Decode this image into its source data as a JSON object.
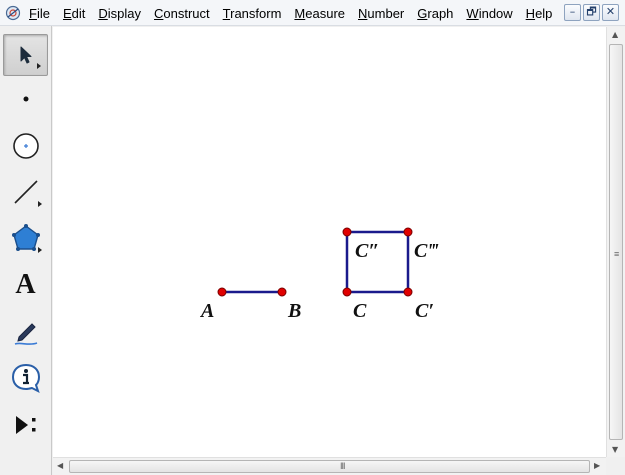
{
  "menu": {
    "items": [
      {
        "ul": "F",
        "rest": "ile"
      },
      {
        "ul": "E",
        "rest": "dit"
      },
      {
        "ul": "D",
        "rest": "isplay"
      },
      {
        "ul": "C",
        "rest": "onstruct"
      },
      {
        "ul": "T",
        "rest": "ransform"
      },
      {
        "ul": "M",
        "rest": "easure"
      },
      {
        "ul": "N",
        "rest": "umber"
      },
      {
        "ul": "G",
        "rest": "raph"
      },
      {
        "ul": "W",
        "rest": "indow"
      },
      {
        "ul": "H",
        "rest": "elp"
      }
    ]
  },
  "window_buttons": {
    "minimize": "–",
    "restore": "🗗",
    "close": "✕"
  },
  "toolbox": {
    "tools": [
      {
        "name": "arrow-tool",
        "icon": "arrow-icon"
      },
      {
        "name": "point-tool",
        "icon": "point-icon"
      },
      {
        "name": "compass-tool",
        "icon": "circle-icon"
      },
      {
        "name": "straightedge-tool",
        "icon": "line-icon"
      },
      {
        "name": "polygon-tool",
        "icon": "pentagon-icon"
      },
      {
        "name": "text-tool",
        "icon": "text-icon",
        "glyph": "A"
      },
      {
        "name": "marker-tool",
        "icon": "pen-icon"
      },
      {
        "name": "information-tool",
        "icon": "info-icon"
      },
      {
        "name": "custom-tool",
        "icon": "play-icon"
      }
    ]
  },
  "sketch": {
    "labels": {
      "A": "A",
      "B": "B",
      "C": "C",
      "C1": "C′",
      "C2": "C″",
      "C3": "C‴"
    },
    "segment_color": "#1a1a8c",
    "point_color": "#e00000"
  },
  "scrollbar": {
    "grip_v": "≡",
    "grip_h": "III"
  }
}
